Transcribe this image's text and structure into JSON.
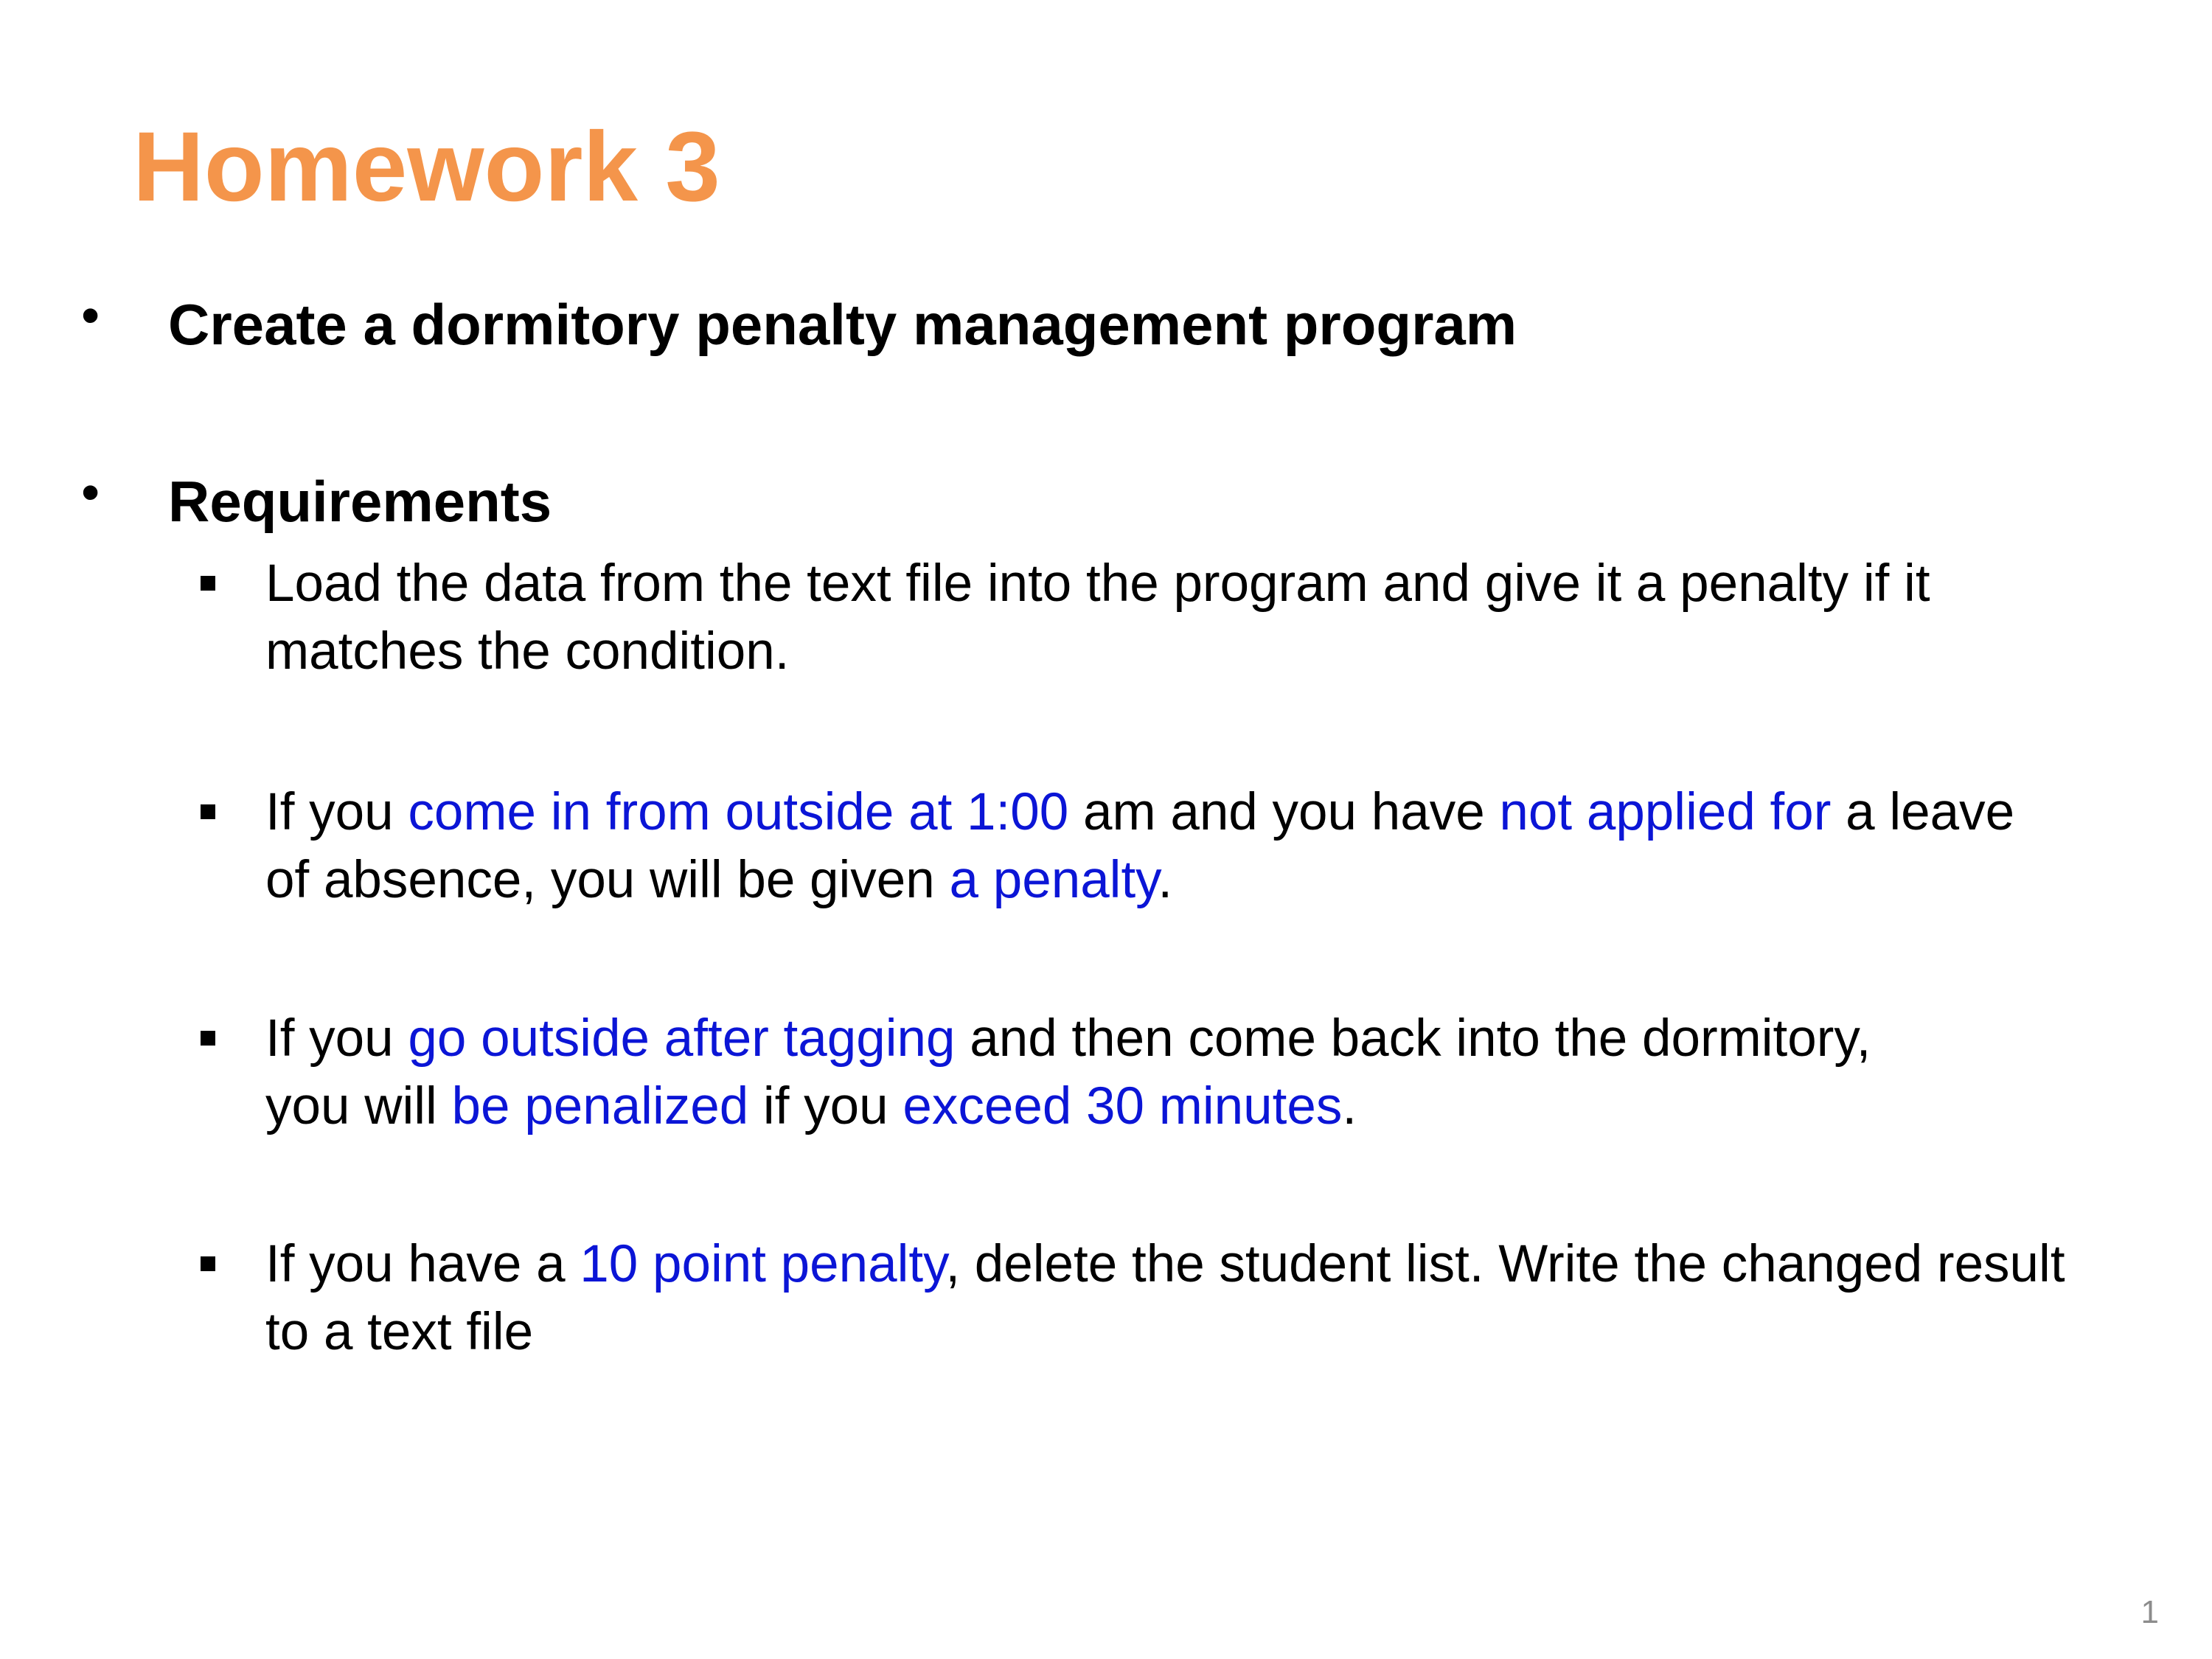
{
  "slide": {
    "title": "Homework 3",
    "page_number": "1",
    "bullets": [
      {
        "marker": "•",
        "text": "Create a dormitory penalty management program"
      },
      {
        "marker": "•",
        "text": "Requirements"
      }
    ],
    "requirements": [
      {
        "marker": "square",
        "line1": "Load the data from the text file into the program and give it a penalty if it",
        "line2": "matches the condition."
      },
      {
        "marker": "square",
        "l1_a": "If you ",
        "l1_b": "come in from outside at 1:00",
        "l1_c": " am and you have ",
        "l1_d": "not applied for",
        "l1_e": " a leave",
        "l2_a": "of absence,  you will be given ",
        "l2_b": "a penalty",
        "l2_c": "."
      },
      {
        "marker": "square",
        "l1_a": "If you ",
        "l1_b": "go outside after tagging",
        "l1_c": " and then come back into the dormitory,",
        "l2_a": "you will ",
        "l2_b": "be penalized",
        "l2_c": " if you ",
        "l2_d": "exceed 30 minutes",
        "l2_e": "."
      },
      {
        "marker": "square",
        "l1_a": "If you have a ",
        "l1_b": "10 point penalty",
        "l1_c": ", delete the student list. Write the changed result",
        "l2_a": "to a text file"
      }
    ],
    "colors": {
      "title": "#f4954b",
      "highlight": "#0b15d6",
      "text": "#000000",
      "page_number": "#8c8c8c"
    }
  }
}
